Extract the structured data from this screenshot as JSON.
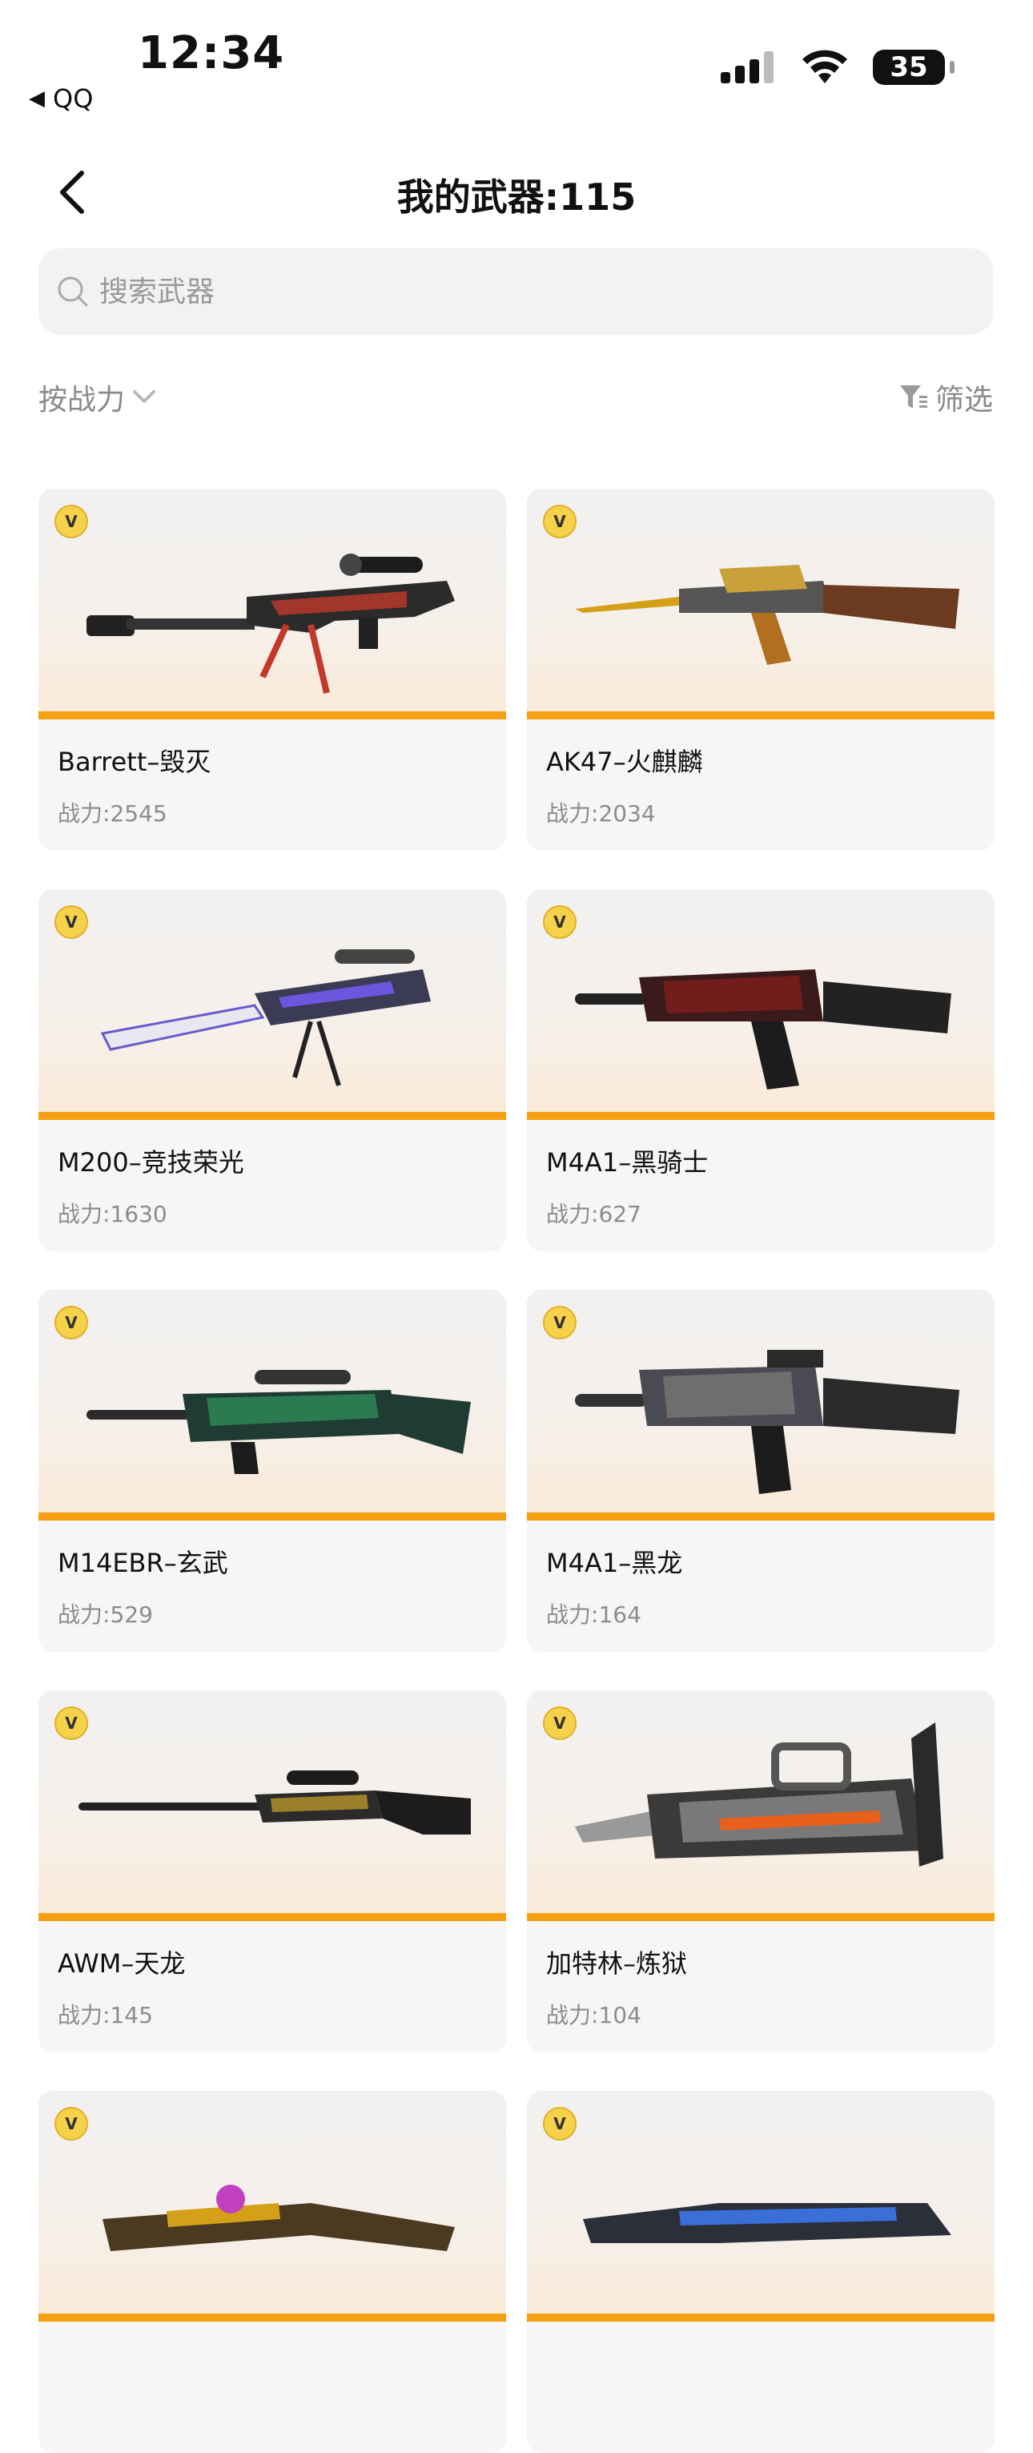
{
  "status": {
    "time": "12:34",
    "back_app": "QQ",
    "battery": "35"
  },
  "header": {
    "title": "我的武器:115"
  },
  "search": {
    "placeholder": "搜索武器"
  },
  "sort": {
    "label": "按战力"
  },
  "filter": {
    "label": "筛选"
  },
  "power_prefix": "战力:",
  "weapons": [
    {
      "name": "Barrett–毁灭",
      "power": "2545"
    },
    {
      "name": "AK47–火麒麟",
      "power": "2034"
    },
    {
      "name": "M200–竞技荣光",
      "power": "1630"
    },
    {
      "name": "M4A1–黑骑士",
      "power": "627"
    },
    {
      "name": "M14EBR–玄武",
      "power": "529"
    },
    {
      "name": "M4A1–黑龙",
      "power": "164"
    },
    {
      "name": "AWM–天龙",
      "power": "145"
    },
    {
      "name": "加特林–炼狱",
      "power": "104"
    }
  ],
  "badge_letter": "V",
  "colors": {
    "accent": "#f5a013",
    "badge": "#f6d24a",
    "text_secondary": "#8c8c8c"
  }
}
